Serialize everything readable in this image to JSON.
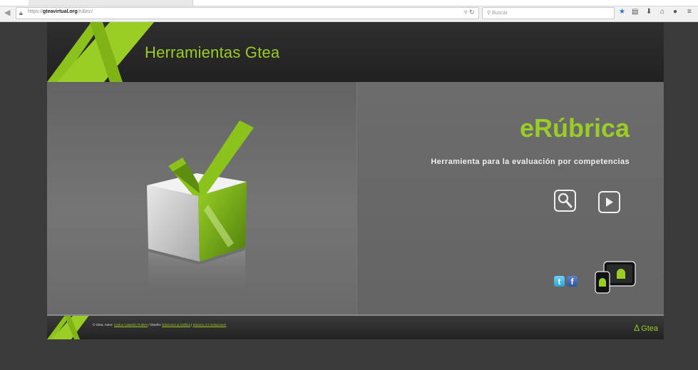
{
  "browser": {
    "url_prefix": "https://",
    "url_domain": "gteavirtual.org",
    "url_path": "/rubric/",
    "search_placeholder": "Buscar",
    "toolbar_icons": [
      "bookmark-star-icon",
      "reading-list-icon",
      "download-icon",
      "home-icon",
      "chat-icon",
      "menu-icon"
    ]
  },
  "header": {
    "title": "Herramientas Gtea"
  },
  "hero": {
    "app_title": "eRúbrica",
    "subtitle": "Herramienta para la evaluación por competencias"
  },
  "social": {
    "twitter_glyph": "t",
    "facebook_glyph": "f"
  },
  "footer": {
    "copyright": "© Gtea. Autor:",
    "author_link": "Carlos Castelón Robles",
    "design_label": " / Diseño:",
    "design_link": "Ediciones & Gráfica",
    "sep": " | ",
    "last_link": "Entorno 2.0 Soluciones",
    "logo_text": "Gtea"
  },
  "colors": {
    "accent": "#9acd25",
    "page_bg": "#3b3b3b",
    "header_bg": "#262626"
  }
}
